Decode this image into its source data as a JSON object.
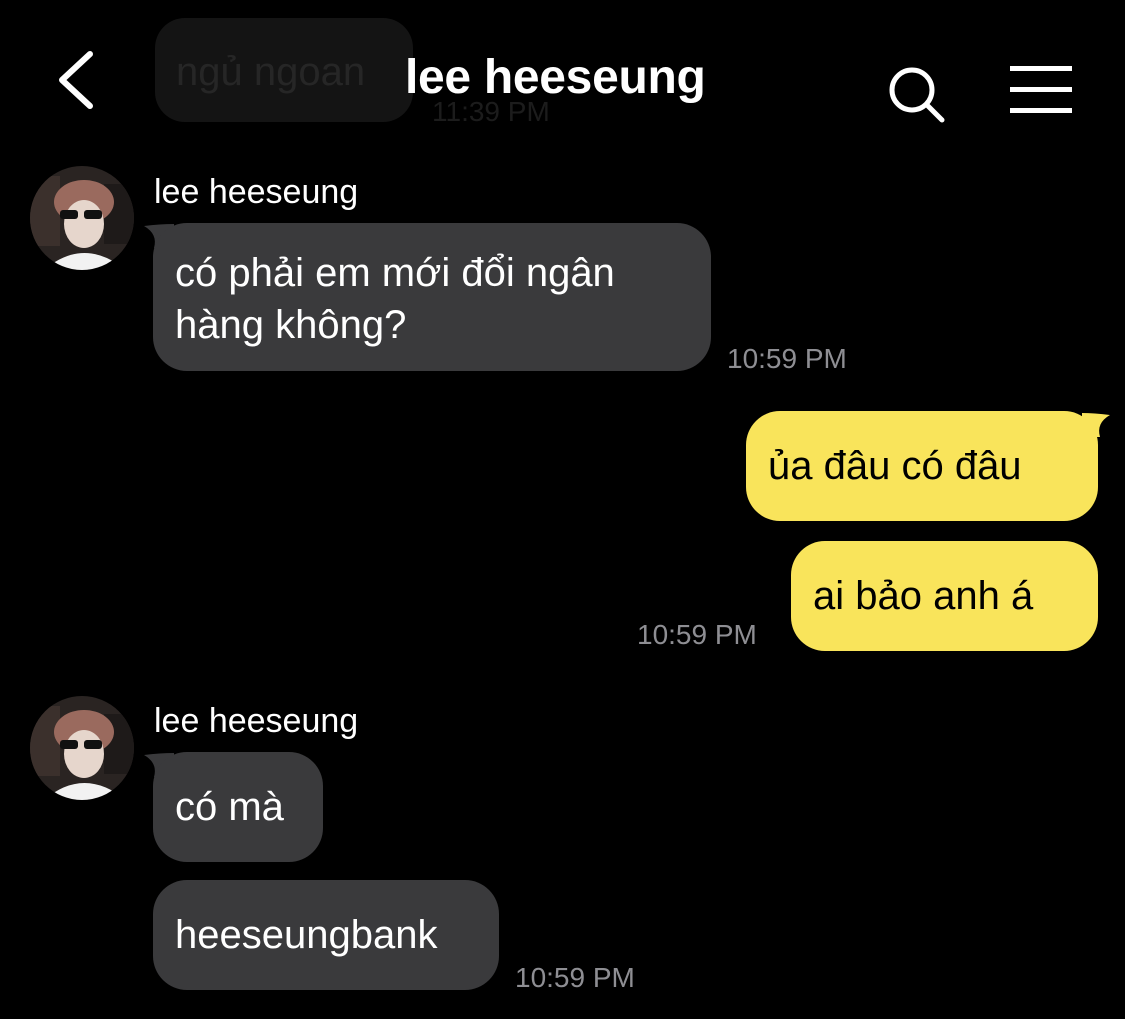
{
  "previous": {
    "text": "ngủ ngoan",
    "time": "11:39 PM"
  },
  "header": {
    "title": "lee heeseung"
  },
  "icons": {
    "back": "chevron-left-icon",
    "search": "search-icon",
    "menu": "hamburger-menu-icon"
  },
  "colors": {
    "background": "#000000",
    "incoming_bubble": "#3a3a3c",
    "outgoing_bubble": "#f9e45b",
    "timestamp": "#8e8e93"
  },
  "messages": {
    "group1": {
      "sender": "lee heeseung",
      "bubble1": "có phải em mới đổi ngân hàng không?",
      "time": "10:59 PM"
    },
    "group2": {
      "bubble1": "ủa đâu có đâu",
      "bubble2": "ai bảo anh á",
      "time": "10:59 PM"
    },
    "group3": {
      "sender": "lee heeseung",
      "bubble1": "có mà",
      "bubble2": "heeseungbank",
      "time": "10:59 PM"
    }
  }
}
